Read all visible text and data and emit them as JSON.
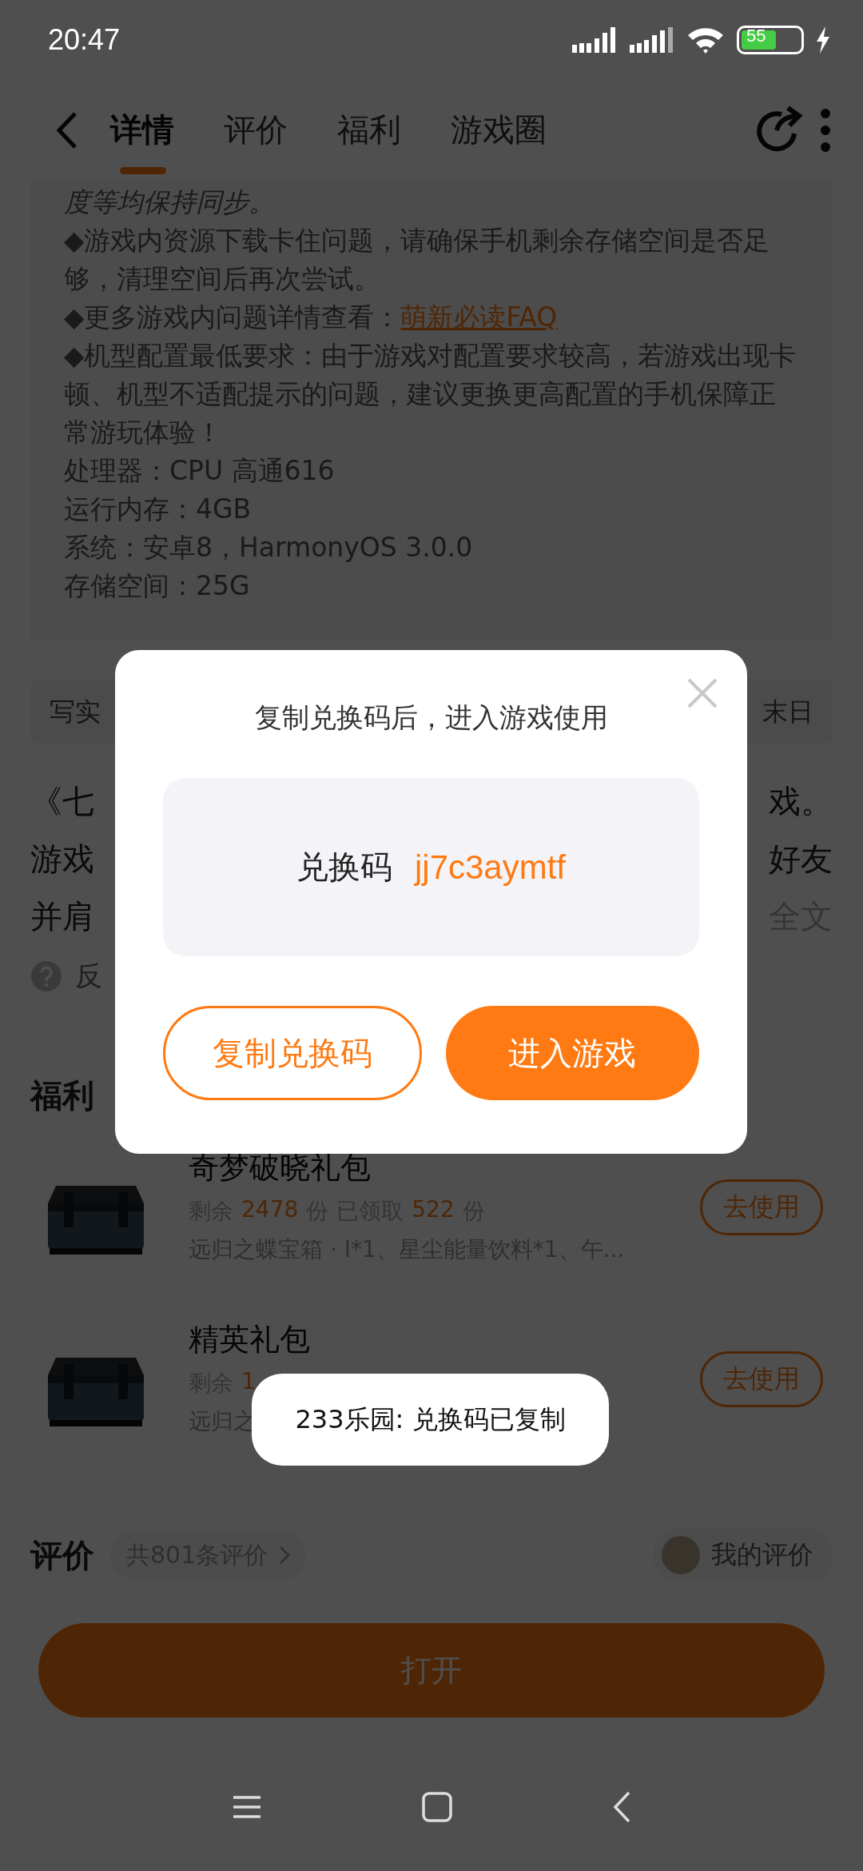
{
  "status_bar": {
    "time": "20:47",
    "battery": "55"
  },
  "tabs": [
    {
      "label": "详情",
      "selected": true
    },
    {
      "label": "评价",
      "selected": false
    },
    {
      "label": "福利",
      "selected": false
    },
    {
      "label": "游戏圈",
      "selected": false
    }
  ],
  "details": [
    {
      "kind": "italic",
      "text": "度等均保持同步。"
    },
    {
      "kind": "plain",
      "text": "◆游戏内资源下载卡住问题，请确保手机剩余存储空间是否足够，清理空间后再次尝试。"
    },
    {
      "kind": "link",
      "text": "◆更多游戏内问题详情查看：",
      "link": "萌新必读FAQ"
    },
    {
      "kind": "plain",
      "text": "◆机型配置最低要求：由于游戏对配置要求较高，若游戏出现卡顿、机型不适配提示的问题，建议更换更高配置的手机保障正常游玩体验！"
    },
    {
      "kind": "plain",
      "text": "处理器：CPU 高通616"
    },
    {
      "kind": "plain",
      "text": "运行内存：4GB"
    },
    {
      "kind": "plain",
      "text": "系统：安卓8，HarmonyOS 3.0.0"
    },
    {
      "kind": "plain",
      "text": "存储空间：25G"
    }
  ],
  "tags": [
    "写实",
    "末日"
  ],
  "description": [
    {
      "left": "《七",
      "right": "戏。",
      "muted": false
    },
    {
      "left": "游戏",
      "right": "好友",
      "muted": false
    },
    {
      "left": "并肩",
      "right": "全文",
      "muted": true
    }
  ],
  "feedback": "反",
  "benefits_title": "福利",
  "gifts": [
    {
      "name": "奇梦破晓礼包",
      "stats": [
        {
          "kind": "label",
          "text": "剩余"
        },
        {
          "kind": "number",
          "text": "2478"
        },
        {
          "kind": "label",
          "text": "份"
        },
        {
          "kind": "label",
          "text": "已领取"
        },
        {
          "kind": "number",
          "text": "522"
        },
        {
          "kind": "label",
          "text": "份"
        }
      ],
      "desc": "远归之蝶宝箱 · Ⅰ*1、星尘能量饮料*1、午...",
      "button": "去使用"
    },
    {
      "name": "精英礼包",
      "stats": [
        {
          "kind": "label",
          "text": "剩余"
        },
        {
          "kind": "number",
          "text": "1"
        }
      ],
      "desc": "远归之",
      "button": "去使用"
    }
  ],
  "reviews": {
    "title": "评价",
    "count": "共801条评价",
    "mine": "我的评价"
  },
  "open_button": "打开",
  "dialog": {
    "title": "复制兑换码后，进入游戏使用",
    "code_label": "兑换码",
    "code": "jj7c3aymtf",
    "copy_button": "复制兑换码",
    "enter_button": "进入游戏"
  },
  "toast": "233乐园: 兑换码已复制"
}
